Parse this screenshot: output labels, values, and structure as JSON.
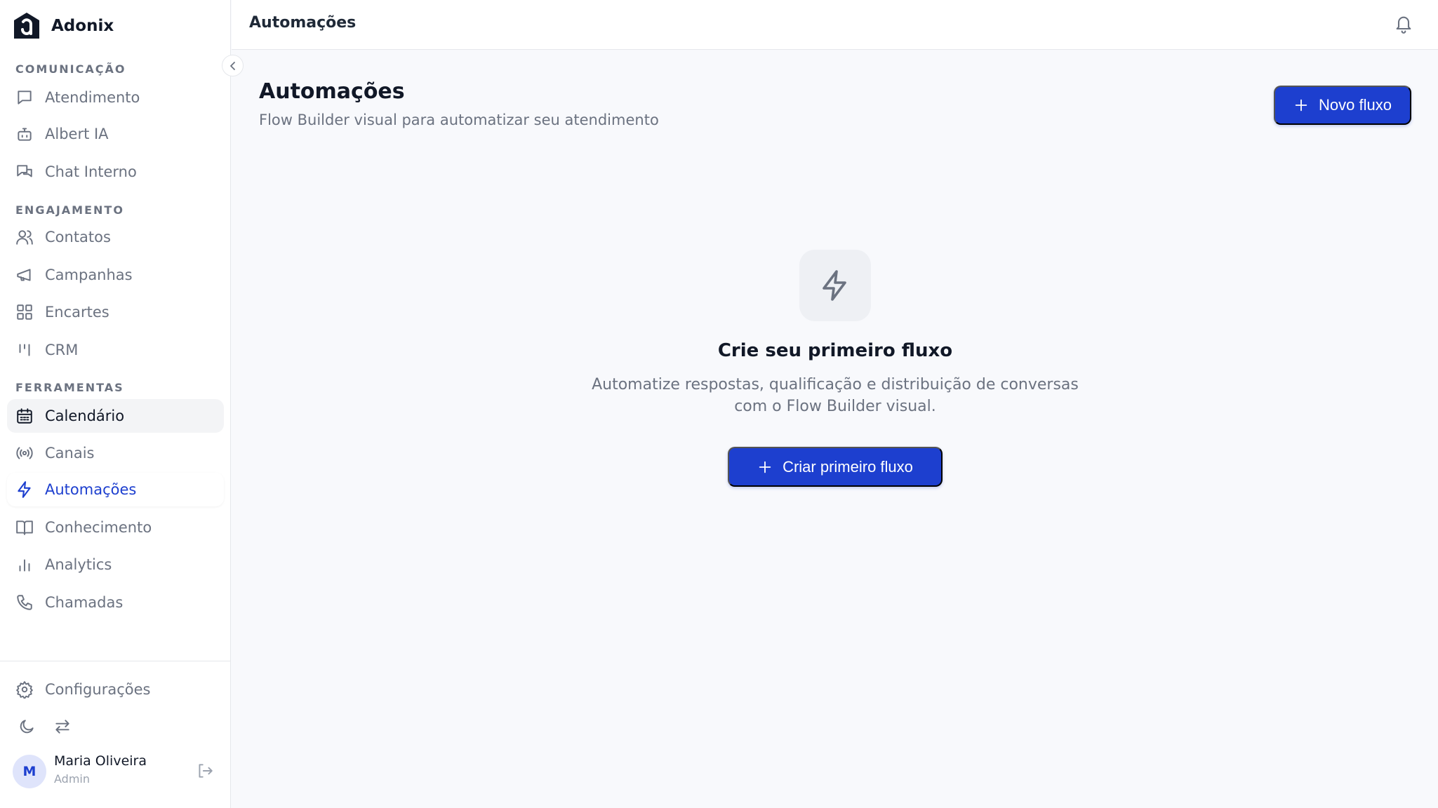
{
  "brand": {
    "name": "Adonix"
  },
  "sidebar": {
    "sections": {
      "comunicacao": "COMUNICAÇÃO",
      "engajamento": "ENGAJAMENTO",
      "ferramentas": "FERRAMENTAS"
    },
    "items": {
      "atendimento": "Atendimento",
      "albert": "Albert IA",
      "chat_interno": "Chat Interno",
      "contatos": "Contatos",
      "campanhas": "Campanhas",
      "encartes": "Encartes",
      "crm": "CRM",
      "calendario": "Calendário",
      "canais": "Canais",
      "automacoes": "Automações",
      "conhecimento": "Conhecimento",
      "analytics": "Analytics",
      "chamadas": "Chamadas"
    },
    "active_item": "Automações",
    "settings_label": "Configurações",
    "user": {
      "initial": "M",
      "name": "Maria Oliveira",
      "role": "Admin"
    }
  },
  "topbar": {
    "title": "Automações"
  },
  "main": {
    "title": "Automações",
    "subtitle": "Flow Builder visual para automatizar seu atendimento",
    "new_flow_label": "Novo fluxo",
    "empty_state": {
      "title": "Crie seu primeiro fluxo",
      "description_line1": "Automatize respostas, qualificação e distribuição de conversas",
      "description_line2": "com o Flow Builder visual.",
      "button_label": "Criar primeiro fluxo"
    }
  },
  "colors": {
    "accent": "#1d3fcf",
    "background": "#f8f9fc",
    "sidebar_bg": "#ffffff",
    "muted_text": "#6b7280"
  }
}
